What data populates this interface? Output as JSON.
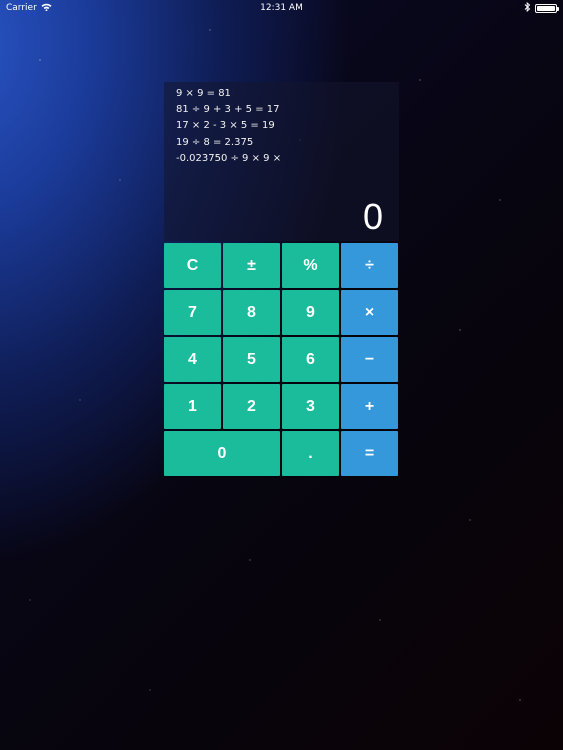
{
  "status_bar": {
    "carrier": "Carrier",
    "time": "12:31 AM"
  },
  "display": {
    "history": [
      "9 × 9 = 81",
      "81 ÷ 9 + 3 + 5 = 17",
      "17 × 2 - 3 × 5 = 19",
      "19 ÷ 8 = 2.375",
      "-0.023750 ÷ 9 × 9 ×"
    ],
    "result": "0"
  },
  "keys": {
    "clear": "C",
    "sign": "±",
    "percent": "%",
    "divide": "÷",
    "seven": "7",
    "eight": "8",
    "nine": "9",
    "multiply": "×",
    "four": "4",
    "five": "5",
    "six": "6",
    "subtract": "−",
    "one": "1",
    "two": "2",
    "three": "3",
    "add": "+",
    "zero": "0",
    "decimal": ".",
    "equals": "="
  },
  "colors": {
    "number_key": "#1abc9c",
    "operator_key": "#3498db"
  }
}
